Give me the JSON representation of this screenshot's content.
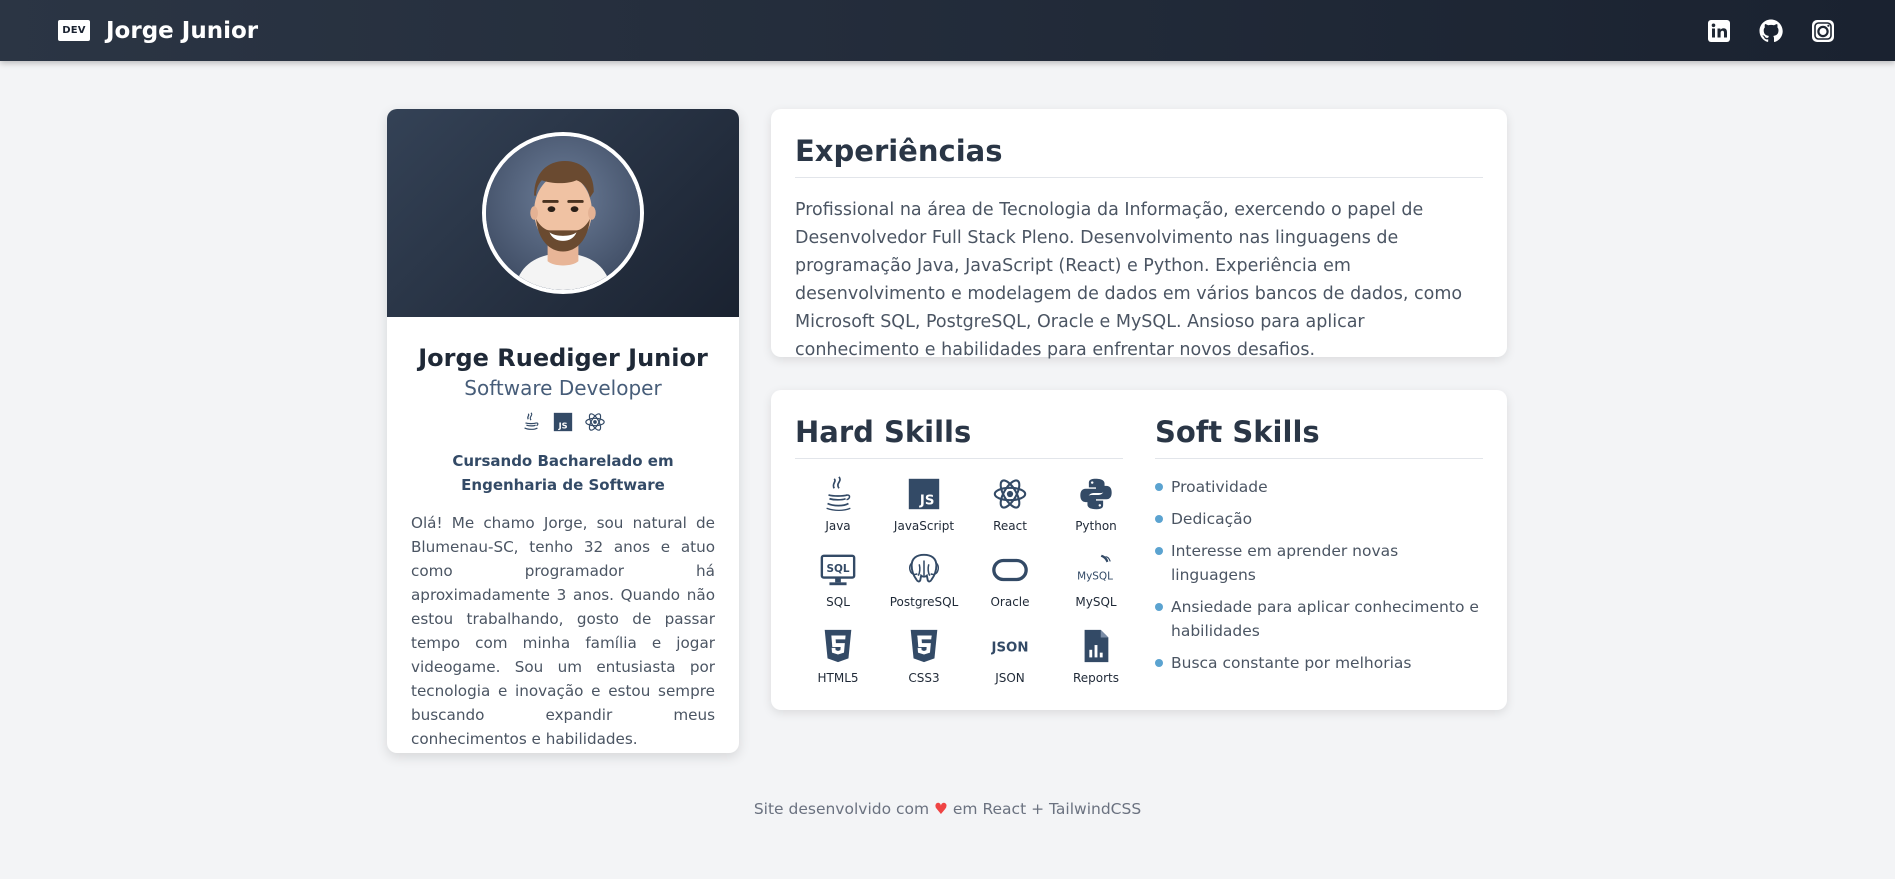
{
  "navbar": {
    "logo_text": "DEV",
    "brand_name": "Jorge Junior",
    "social_icons": [
      "linkedin-icon",
      "github-icon",
      "instagram-icon"
    ]
  },
  "profile": {
    "name": "Jorge Ruediger Junior",
    "role": "Software Developer",
    "tech_icons": [
      "java-icon",
      "javascript-icon",
      "react-icon"
    ],
    "degree": "Cursando Bacharelado em Engenharia de Software",
    "bio": "Olá! Me chamo Jorge, sou natural de Blumenau-SC, tenho 32 anos e atuo como programador há aproximadamente 3 anos. Quando não estou trabalhando, gosto de passar tempo com minha família e jogar videogame. Sou um entusiasta por tecnologia e inovação e estou sempre buscando expandir meus conhecimentos e habilidades."
  },
  "experience": {
    "title": "Experiências",
    "text": "Profissional na área de Tecnologia da Informação, exercendo o papel de Desenvolvedor Full Stack Pleno. Desenvolvimento nas linguagens de programação Java, JavaScript (React) e Python. Experiência em desenvolvimento e modelagem de dados em vários bancos de dados, como Microsoft SQL, PostgreSQL, Oracle e MySQL. Ansioso para aplicar conhecimento e habilidades para enfrentar novos desafios."
  },
  "hard_skills": {
    "title": "Hard Skills",
    "items": [
      {
        "label": "Java",
        "icon": "java-icon"
      },
      {
        "label": "JavaScript",
        "icon": "javascript-icon"
      },
      {
        "label": "React",
        "icon": "react-icon"
      },
      {
        "label": "Python",
        "icon": "python-icon"
      },
      {
        "label": "SQL",
        "icon": "sql-icon"
      },
      {
        "label": "PostgreSQL",
        "icon": "postgresql-icon"
      },
      {
        "label": "Oracle",
        "icon": "oracle-icon"
      },
      {
        "label": "MySQL",
        "icon": "mysql-icon"
      },
      {
        "label": "HTML5",
        "icon": "html5-icon"
      },
      {
        "label": "CSS3",
        "icon": "css3-icon"
      },
      {
        "label": "JSON",
        "icon": "json-icon"
      },
      {
        "label": "Reports",
        "icon": "reports-icon"
      }
    ]
  },
  "soft_skills": {
    "title": "Soft Skills",
    "items": [
      "Proatividade",
      "Dedicação",
      "Interesse em aprender novas linguagens",
      "Ansiedade para aplicar conhecimento e habilidades",
      "Busca constante por melhorias"
    ]
  },
  "footer": {
    "prefix": "Site desenvolvido com",
    "heart": "♥",
    "suffix": "em React + TailwindCSS"
  },
  "colors": {
    "navbar": "#1f2937",
    "accent": "#334a66",
    "bullet": "#5ba3d0",
    "heart": "#ef4444"
  }
}
